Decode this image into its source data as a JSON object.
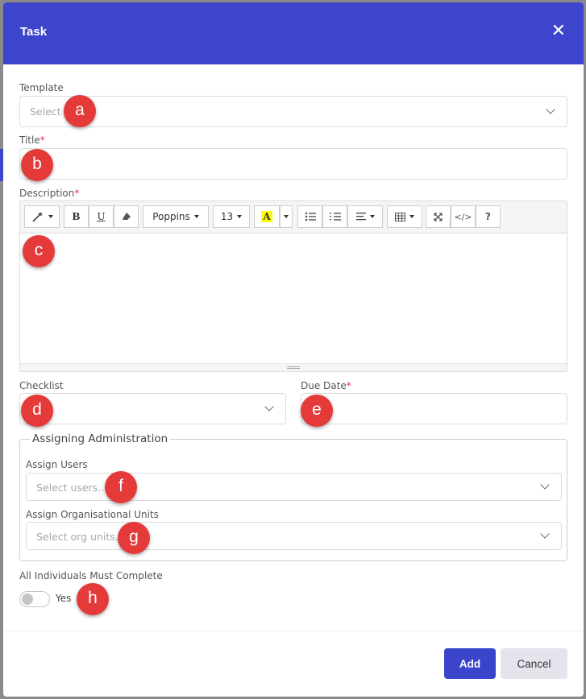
{
  "modal": {
    "title": "Task",
    "close_icon": "close-icon"
  },
  "template": {
    "label": "Template",
    "placeholder": "Select"
  },
  "title_field": {
    "label": "Title",
    "required_mark": "*"
  },
  "description": {
    "label": "Description",
    "required_mark": "*",
    "toolbar": {
      "font_name": "Poppins",
      "font_size": "13",
      "bold": "B",
      "underline": "U",
      "highlight": "A",
      "help": "?",
      "code": "</>"
    }
  },
  "checklist": {
    "label": "Checklist"
  },
  "due_date": {
    "label": "Due Date",
    "required_mark": "*"
  },
  "assigning": {
    "legend": "Assigning Administration",
    "users": {
      "label": "Assign Users",
      "placeholder": "Select users..."
    },
    "org_units": {
      "label": "Assign Organisational Units",
      "placeholder": "Select org units..."
    }
  },
  "all_individuals": {
    "label": "All Individuals Must Complete",
    "toggle_label": "Yes",
    "value": false
  },
  "buttons": {
    "add": "Add",
    "cancel": "Cancel"
  },
  "markers": [
    "a",
    "b",
    "c",
    "d",
    "e",
    "f",
    "g",
    "h"
  ],
  "colors": {
    "header": "#3c45cb",
    "primary_button": "#3a45cc",
    "required": "#e0334d",
    "marker": "#e53a3a"
  }
}
